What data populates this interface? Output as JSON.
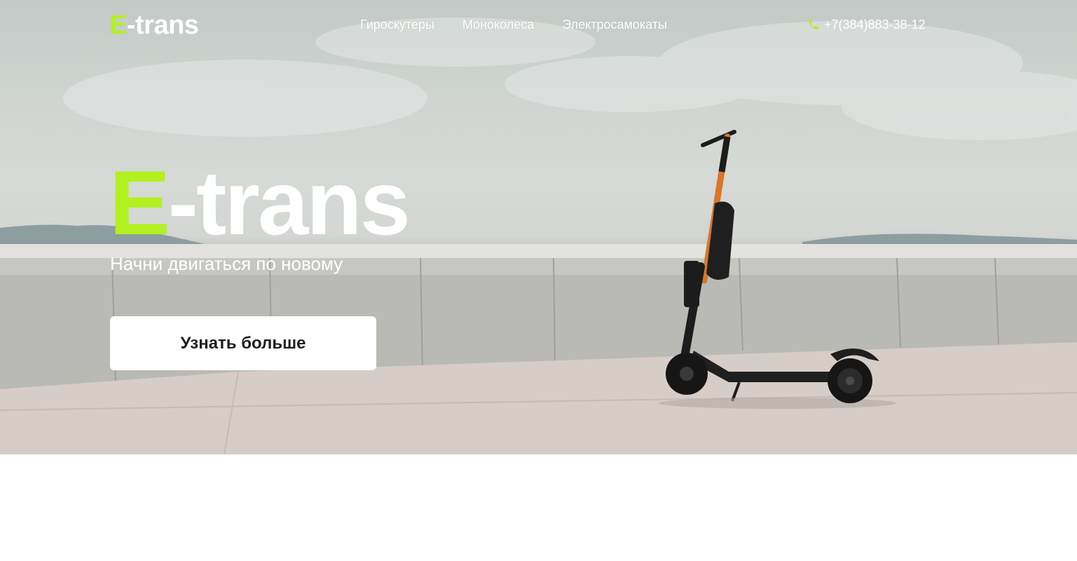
{
  "header": {
    "logo_accent": "E",
    "logo_rest": "-trans",
    "nav": [
      {
        "label": "Гироскутеры"
      },
      {
        "label": "Моноколеса"
      },
      {
        "label": "Электросамокаты"
      }
    ],
    "phone": "+7(384)883-38-12",
    "phone_icon": "phone-icon"
  },
  "hero": {
    "title_accent": "E",
    "title_rest": "-trans",
    "tagline": "Начни двигаться по новому",
    "cta_label": "Узнать больше",
    "background_image": "electric-scooter-on-promenade"
  },
  "colors": {
    "accent": "#b3f01f",
    "text_light": "#ffffff",
    "button_bg": "#ffffff",
    "button_text": "#1e1e1e"
  }
}
